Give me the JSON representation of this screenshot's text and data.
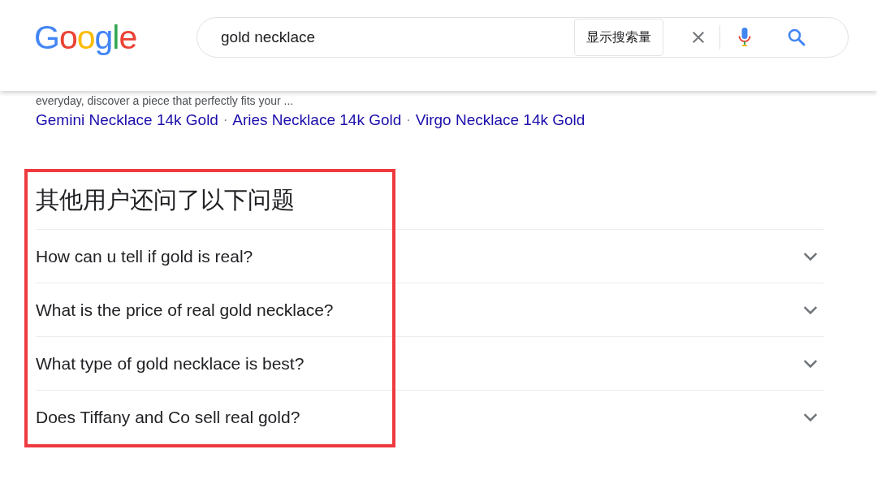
{
  "header": {
    "logo": "Google",
    "search": {
      "value": "gold necklace"
    },
    "search_volume_button": "显示搜索量"
  },
  "result": {
    "snippet": "everyday, discover a piece that perfectly fits your ...",
    "sitelinks": [
      {
        "label": "Gemini Necklace 14k Gold"
      },
      {
        "label": "Aries Necklace 14k Gold"
      },
      {
        "label": "Virgo Necklace 14k Gold"
      }
    ],
    "separator": "·"
  },
  "people_also_ask": {
    "title": "其他用户还问了以下问题",
    "highlighted": true,
    "questions": [
      {
        "text": "How can u tell if gold is real?",
        "expanded": false
      },
      {
        "text": "What is the price of real gold necklace?",
        "expanded": false
      },
      {
        "text": "What type of gold necklace is best?",
        "expanded": false
      },
      {
        "text": "Does Tiffany and Co sell real gold?",
        "expanded": false
      }
    ]
  }
}
